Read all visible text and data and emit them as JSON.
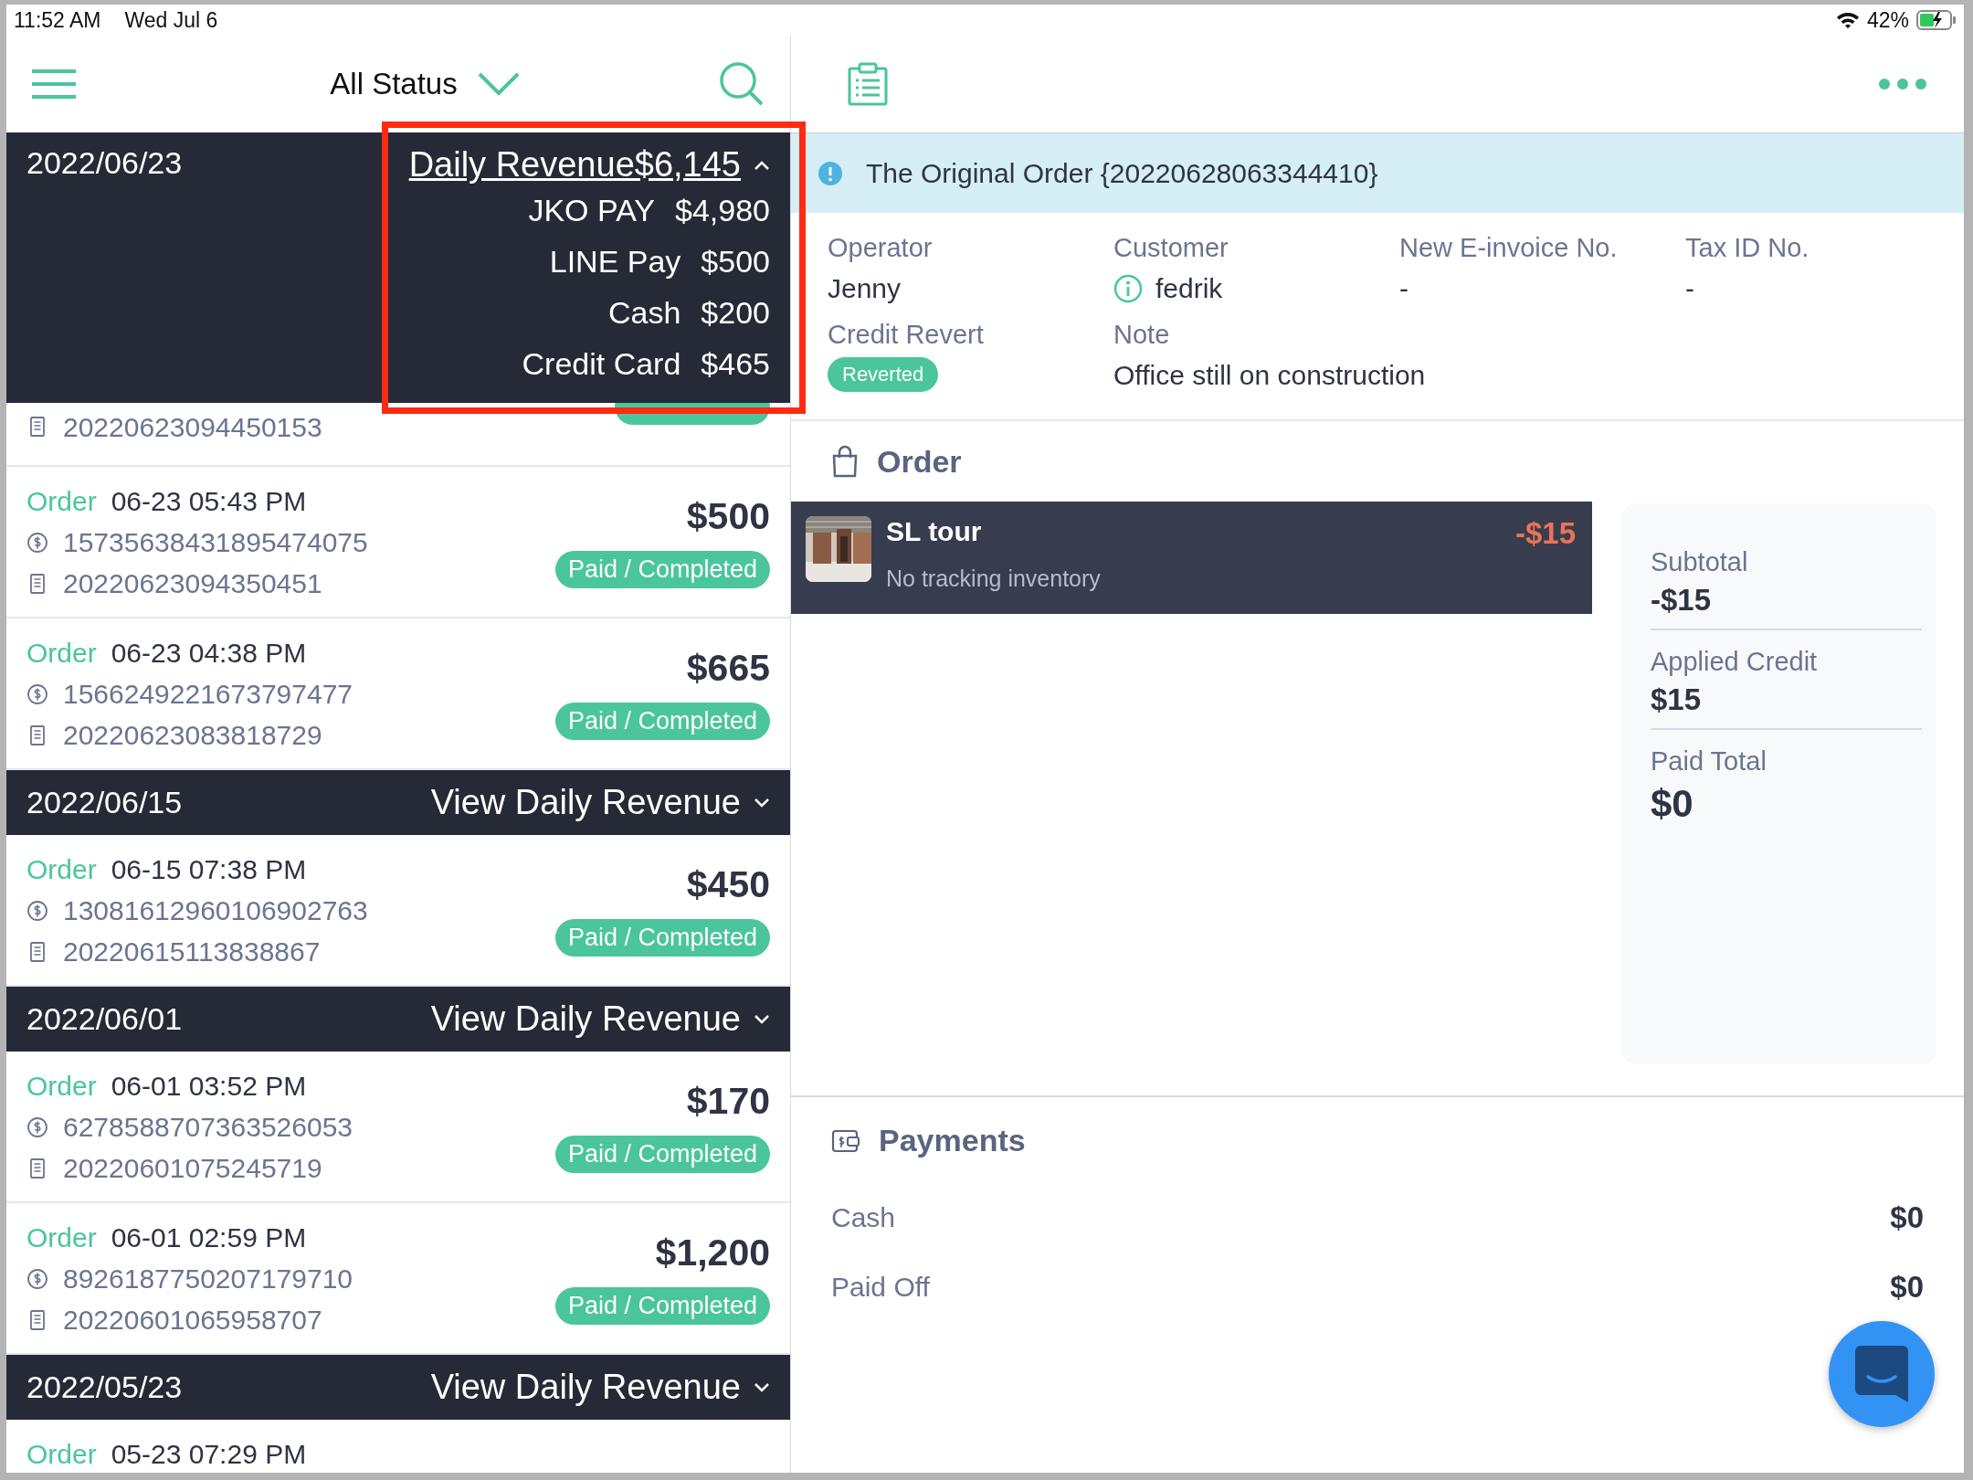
{
  "status_bar": {
    "time": "11:52 AM",
    "date": "Wed Jul 6",
    "battery": "42%"
  },
  "list_nav": {
    "filter": "All Status"
  },
  "date_groups": [
    {
      "date": "2022/06/23",
      "expanded": true,
      "toggle": "Daily Revenue$6,145",
      "breakdown": [
        {
          "method": "JKO PAY",
          "amount": "$4,980"
        },
        {
          "method": "LINE Pay",
          "amount": "$500"
        },
        {
          "method": "Cash",
          "amount": "$200"
        },
        {
          "method": "Credit Card",
          "amount": "$465"
        }
      ],
      "orders": [
        {
          "receipt": "20220623094450153"
        },
        {
          "label": "Order",
          "time": "06-23 05:43 PM",
          "payment_id": "15735638431895474075",
          "receipt": "20220623094350451",
          "amount": "$500",
          "status": "Paid / Completed"
        },
        {
          "label": "Order",
          "time": "06-23 04:38 PM",
          "payment_id": "1566249221673797477",
          "receipt": "20220623083818729",
          "amount": "$665",
          "status": "Paid / Completed"
        }
      ]
    },
    {
      "date": "2022/06/15",
      "expanded": false,
      "toggle": "View Daily Revenue",
      "orders": [
        {
          "label": "Order",
          "time": "06-15 07:38 PM",
          "payment_id": "13081612960106902763",
          "receipt": "20220615113838867",
          "amount": "$450",
          "status": "Paid / Completed"
        }
      ]
    },
    {
      "date": "2022/06/01",
      "expanded": false,
      "toggle": "View Daily Revenue",
      "orders": [
        {
          "label": "Order",
          "time": "06-01 03:52 PM",
          "payment_id": "6278588707363526053",
          "receipt": "20220601075245719",
          "amount": "$170",
          "status": "Paid / Completed"
        },
        {
          "label": "Order",
          "time": "06-01 02:59 PM",
          "payment_id": "8926187750207179710",
          "receipt": "20220601065958707",
          "amount": "$1,200",
          "status": "Paid / Completed"
        }
      ]
    },
    {
      "date": "2022/05/23",
      "expanded": false,
      "toggle": "View Daily Revenue",
      "orders": [
        {
          "label": "Order",
          "time": "05-23 07:29 PM"
        }
      ]
    }
  ],
  "banner": {
    "text": "The Original Order {20220628063344410}"
  },
  "details": [
    {
      "label": "Operator",
      "value": "Jenny"
    },
    {
      "label": "Customer",
      "value": "fedrik",
      "kind": "customer"
    },
    {
      "label": "New E-invoice No.",
      "value": "-"
    },
    {
      "label": "Tax ID No.",
      "value": "-"
    },
    {
      "label": "Credit Revert",
      "value": "Reverted",
      "kind": "tag"
    },
    {
      "label": "Note",
      "value": "Office still on construction"
    }
  ],
  "order": {
    "heading": "Order",
    "items": [
      {
        "name": "SL tour",
        "note": "No tracking inventory",
        "price": "-$15"
      }
    ],
    "summary": [
      {
        "label": "Subtotal",
        "value": "-$15"
      },
      {
        "label": "Applied Credit",
        "value": "$15"
      },
      {
        "label": "Paid Total",
        "value": "$0"
      }
    ]
  },
  "payments": {
    "heading": "Payments",
    "rows": [
      {
        "label": "Cash",
        "value": "$0"
      },
      {
        "label": "Paid Off",
        "value": "$0"
      }
    ]
  }
}
